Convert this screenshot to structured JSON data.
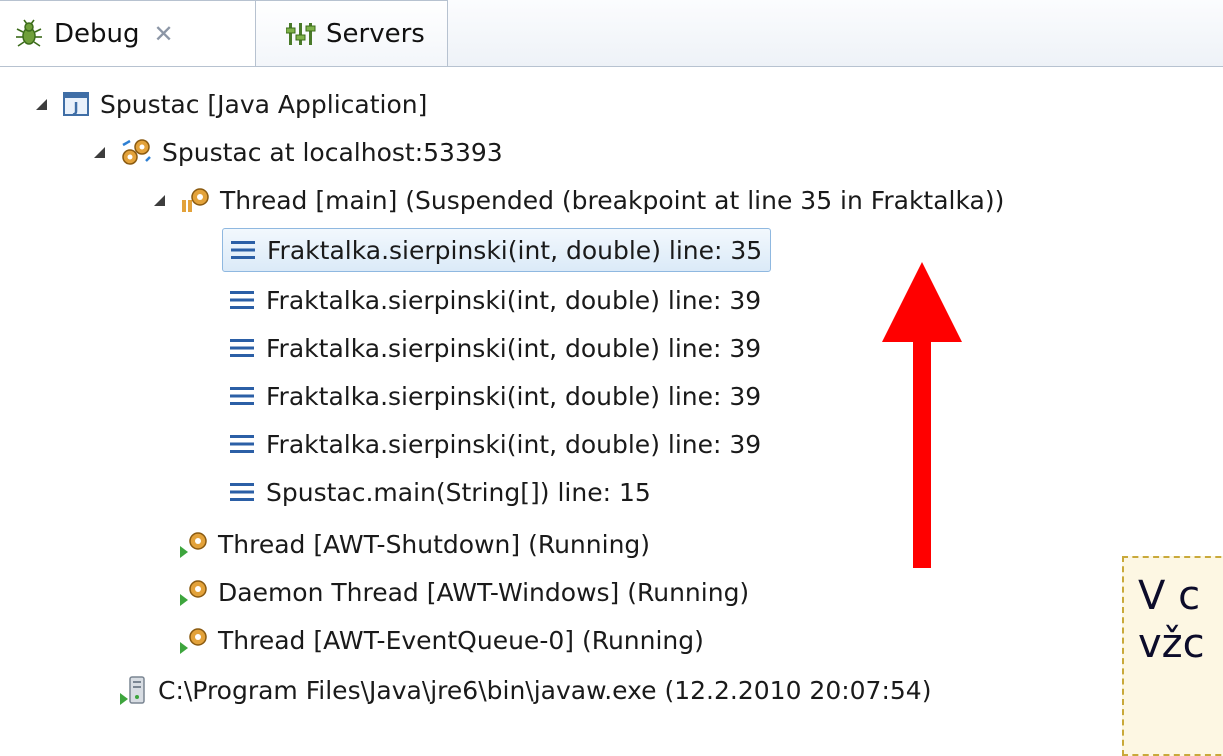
{
  "tabs": {
    "debug_label": "Debug",
    "debug_close": "✕",
    "servers_label": "Servers"
  },
  "tree": {
    "app": "Spustac [Java Application]",
    "vm": "Spustac at localhost:53393",
    "thread_main": "Thread [main] (Suspended (breakpoint at line 35 in Fraktalka))",
    "frames": [
      "Fraktalka.sierpinski(int, double) line: 35",
      "Fraktalka.sierpinski(int, double) line: 39",
      "Fraktalka.sierpinski(int, double) line: 39",
      "Fraktalka.sierpinski(int, double) line: 39",
      "Fraktalka.sierpinski(int, double) line: 39",
      "Spustac.main(String[]) line: 15"
    ],
    "threads": [
      "Thread [AWT-Shutdown] (Running)",
      "Daemon Thread [AWT-Windows] (Running)",
      "Thread [AWT-EventQueue-0] (Running)"
    ],
    "process": "C:\\Program Files\\Java\\jre6\\bin\\javaw.exe (12.2.2010 20:07:54)"
  },
  "note": {
    "line1": "V c",
    "line2": "vžc"
  },
  "colors": {
    "arrow": "#ff0000",
    "selection_border": "#8fb8e0",
    "note_border": "#c9a93a"
  }
}
